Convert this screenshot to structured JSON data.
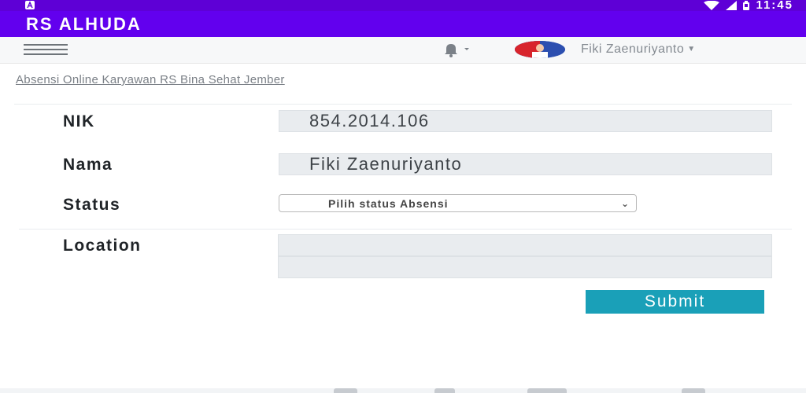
{
  "status_bar": {
    "time": "11:45",
    "icons": [
      "notification-a-icon",
      "wifi-icon",
      "cell-signal-icon",
      "battery-icon"
    ]
  },
  "app_bar": {
    "title": "RS ALHUDA"
  },
  "nav": {
    "user_name": "Fiki Zaenuriyanto",
    "icons": [
      "hamburger-menu-icon",
      "bell-icon",
      "avatar"
    ]
  },
  "breadcrumb": "Absensi Online Karyawan RS Bina Sehat Jember",
  "form": {
    "nik_label": "NIK",
    "nik_value": "854.2014.106",
    "nama_label": "Nama",
    "nama_value": "Fiki Zaenuriyanto",
    "status_label": "Status",
    "status_placeholder": "Pilih status Absensi",
    "location_label": "Location",
    "location_value": "",
    "submit_label": "Submit"
  },
  "colors": {
    "status_bar": "#5e00d6",
    "app_bar": "#6200ee",
    "submit_button": "#1aa0b8",
    "input_bg": "#e9ecef"
  }
}
